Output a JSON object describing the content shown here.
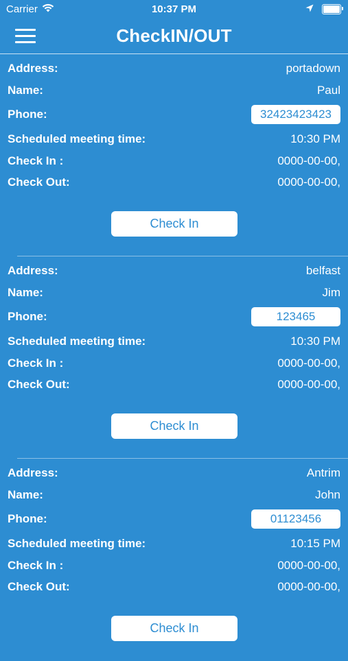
{
  "status_bar": {
    "carrier": "Carrier",
    "time": "10:37 PM",
    "battery_level": 1.0
  },
  "nav": {
    "title": "CheckIN/OUT"
  },
  "labels": {
    "address": "Address:",
    "name": "Name:",
    "phone": "Phone:",
    "scheduled": "Scheduled meeting time:",
    "check_in": "Check In :",
    "check_out": "Check Out:",
    "button": "Check In"
  },
  "entries": [
    {
      "address": "portadown",
      "name": "Paul",
      "phone": "32423423423",
      "scheduled": "10:30 PM",
      "check_in": "0000-00-00,",
      "check_out": "0000-00-00,"
    },
    {
      "address": "belfast",
      "name": "Jim",
      "phone": "123465",
      "scheduled": "10:30 PM",
      "check_in": "0000-00-00,",
      "check_out": "0000-00-00,"
    },
    {
      "address": "Antrim",
      "name": "John",
      "phone": "01123456",
      "scheduled": "10:15 PM",
      "check_in": "0000-00-00,",
      "check_out": "0000-00-00,"
    }
  ],
  "colors": {
    "background": "#2d8dd2",
    "foreground": "#ffffff",
    "accent_text": "#2d8dd2"
  },
  "icons": {
    "wifi": "wifi-icon",
    "location": "location-arrow-icon",
    "battery": "battery-icon",
    "menu": "hamburger-menu-icon"
  }
}
